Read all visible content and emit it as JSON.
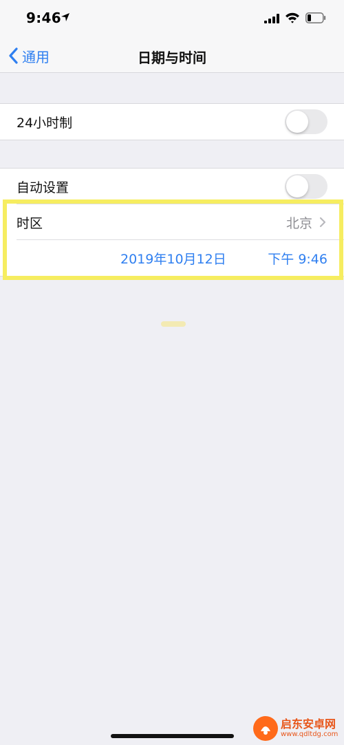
{
  "status_bar": {
    "time": "9:46"
  },
  "nav": {
    "back_label": "通用",
    "title": "日期与时间"
  },
  "groups": {
    "clock_format": {
      "label": "24小时制",
      "toggle_on": false
    },
    "auto_set": {
      "label": "自动设置",
      "toggle_on": false
    },
    "timezone": {
      "label": "时区",
      "value": "北京"
    },
    "datetime": {
      "date": "2019年10月12日",
      "time": "下午 9:46"
    }
  },
  "colors": {
    "accent": "#2f7ff0",
    "highlight": "#f6ed60",
    "background": "#efeff4"
  },
  "watermark": {
    "name": "启东安卓网",
    "url": "www.qdltdg.com"
  }
}
